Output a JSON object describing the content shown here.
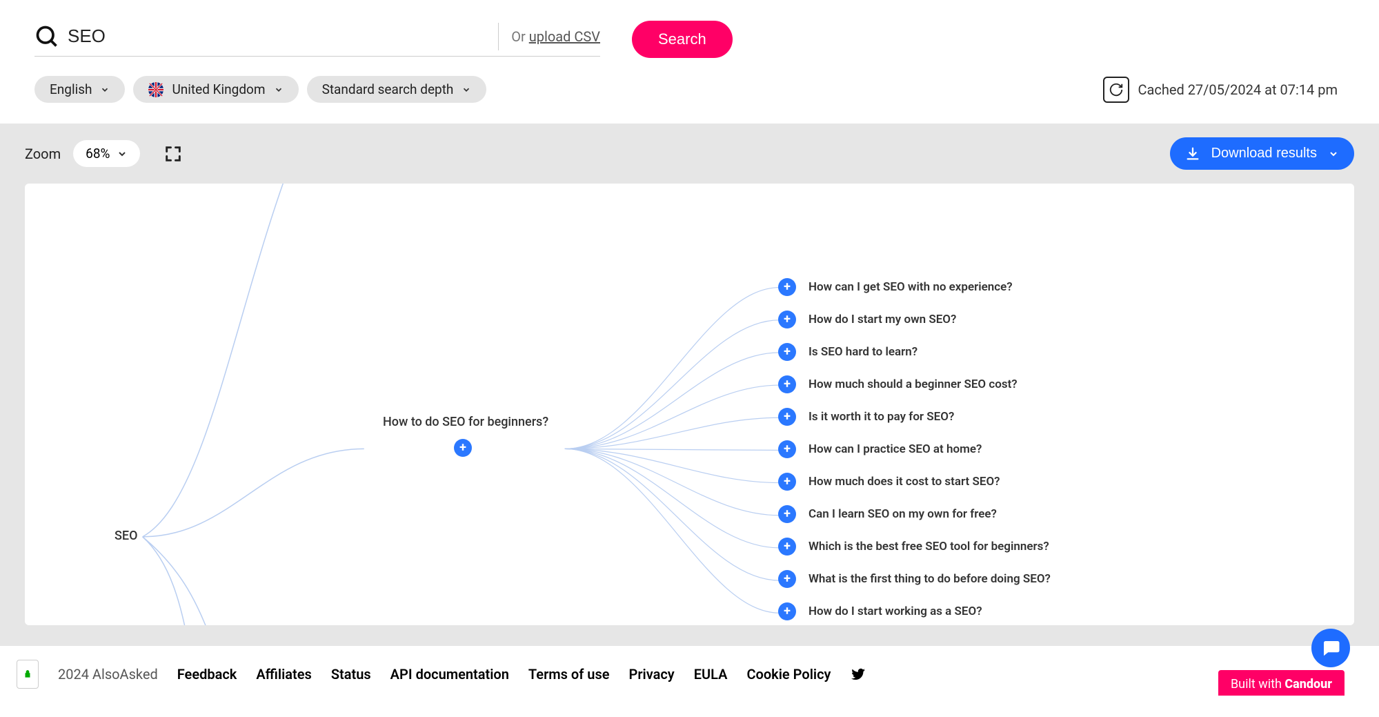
{
  "search": {
    "value": "SEO",
    "or_text": "Or ",
    "upload_text": "upload CSV",
    "button": "Search"
  },
  "filters": {
    "language": "English",
    "region": "United Kingdom",
    "depth": "Standard search depth"
  },
  "cache": "Cached 27/05/2024 at 07:14 pm",
  "toolbar": {
    "zoom_label": "Zoom",
    "zoom_value": "68%",
    "download": "Download results"
  },
  "tree": {
    "root": "SEO",
    "mid": "How to do SEO for beginners?",
    "leaves": [
      "How can I get SEO with no experience?",
      "How do I start my own SEO?",
      "Is SEO hard to learn?",
      "How much should a beginner SEO cost?",
      "Is it worth it to pay for SEO?",
      "How can I practice SEO at home?",
      "How much does it cost to start SEO?",
      "Can I learn SEO on my own for free?",
      "Which is the best free SEO tool for beginners?",
      "What is the first thing to do before doing SEO?",
      "How do I start working as a SEO?"
    ]
  },
  "footer": {
    "copyright": "2024 AlsoAsked",
    "links": [
      "Feedback",
      "Affiliates",
      "Status",
      "API documentation",
      "Terms of use",
      "Privacy",
      "EULA",
      "Cookie Policy"
    ],
    "candour_prefix": "Built with ",
    "candour_brand": "Candour"
  }
}
